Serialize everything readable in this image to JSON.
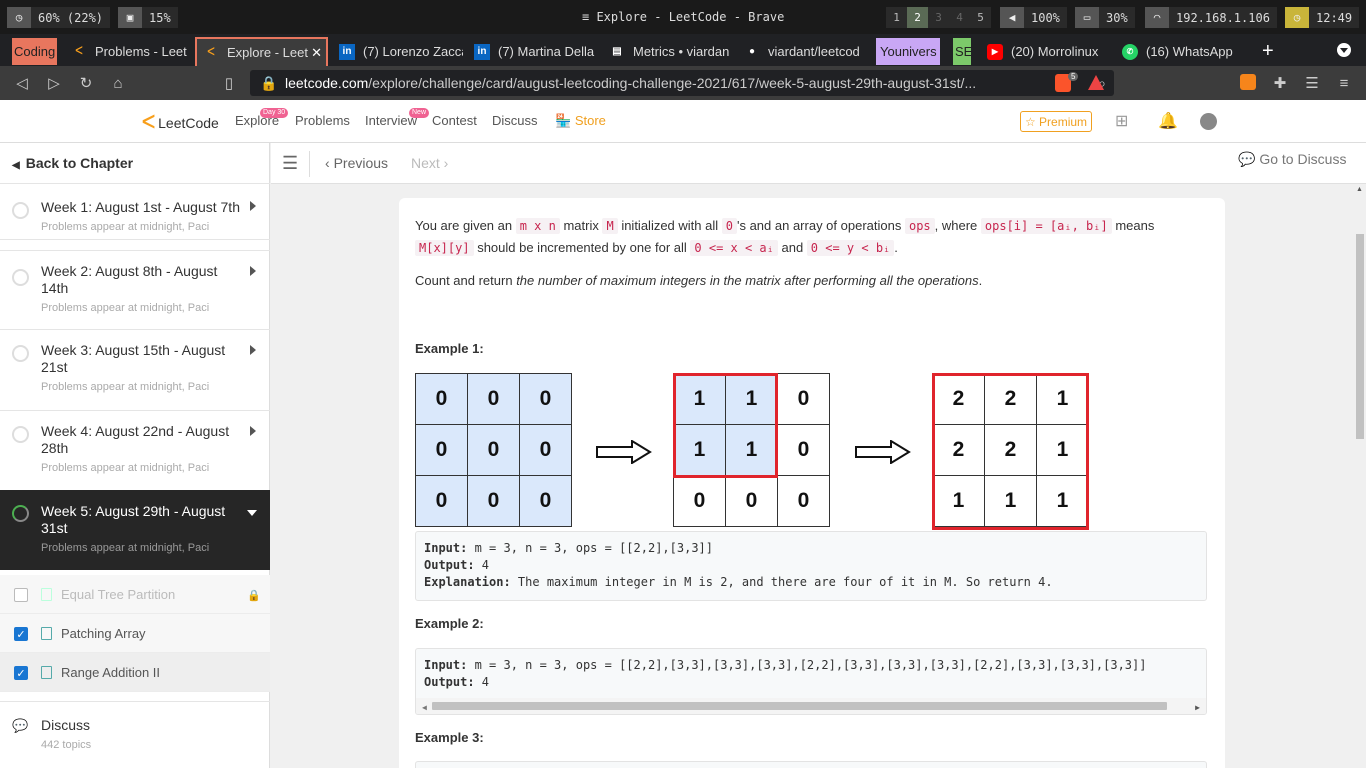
{
  "system": {
    "cpu": "60% (22%)",
    "mem": "15%",
    "window_title": "Explore - LeetCode - Brave",
    "workspaces": [
      "1",
      "2",
      "3",
      "4",
      "5"
    ],
    "volume": "100%",
    "battery": "30%",
    "ip": "192.168.1.106",
    "time": "12:49"
  },
  "tabs": [
    {
      "label": "Coding"
    },
    {
      "label": "Problems - LeetC"
    },
    {
      "label": "Explore - Leet"
    },
    {
      "label": "(7) Lorenzo Zacca"
    },
    {
      "label": "(7) Martina Della"
    },
    {
      "label": "Metrics • viardan"
    },
    {
      "label": "viardant/leetcod"
    },
    {
      "label": "Younivers"
    },
    {
      "label": "SE"
    },
    {
      "label": "(20) Morrolinux"
    },
    {
      "label": "(16) WhatsApp"
    }
  ],
  "address": {
    "domain": "leetcode.com",
    "path": "/explore/challenge/card/august-leetcoding-challenge-2021/617/week-5-august-29th-august-31st/...",
    "shield_count": "5"
  },
  "lcnav": {
    "logo": "LeetCode",
    "items": [
      "Explore",
      "Problems",
      "Interview",
      "Contest",
      "Discuss",
      "Store"
    ],
    "explore_badge": "Day 30",
    "interview_badge": "New",
    "premium": "Premium"
  },
  "sidebar": {
    "back": "Back to Chapter",
    "weeks": [
      {
        "title": "Week 1: August 1st - August 7th",
        "sub": "Problems appear at midnight, Pacific"
      },
      {
        "title": "Week 2: August 8th - August 14th",
        "sub": "Problems appear at midnight, Pacific"
      },
      {
        "title": "Week 3: August 15th - August 21st",
        "sub": "Problems appear at midnight, Pacific"
      },
      {
        "title": "Week 4: August 22nd - August 28th",
        "sub": "Problems appear at midnight, Pacific"
      },
      {
        "title": "Week 5: August 29th - August 31st",
        "sub": "Problems appear at midnight, Pacific"
      }
    ],
    "problems": [
      "Equal Tree Partition",
      "Patching Array",
      "Range Addition II"
    ],
    "discuss": "Discuss",
    "discuss_sub": "442 topics"
  },
  "toolbar": {
    "previous": "Previous",
    "next": "Next",
    "go_discuss": "Go to Discuss"
  },
  "problem": {
    "p1_a": "You are given an ",
    "p1_code1": "m x n",
    "p1_b": " matrix ",
    "p1_code2": "M",
    "p1_c": " initialized with all ",
    "p1_code3": "0",
    "p1_d": "'s and an array of operations ",
    "p1_code4": "ops",
    "p1_e": ", where ",
    "p1_code5": "ops[i] = [aᵢ, bᵢ]",
    "p1_f": " means",
    "p2_code1": "M[x][y]",
    "p2_a": " should be incremented by one for all ",
    "p2_code2": "0 <= x < aᵢ",
    "p2_b": " and ",
    "p2_code3": "0 <= y < bᵢ",
    "p2_c": ".",
    "p3_a": "Count and return ",
    "p3_em": "the number of maximum integers in the matrix after performing all the operations",
    "p3_b": ".",
    "ex1_title": "Example 1:",
    "grid1": [
      [
        "0",
        "0",
        "0"
      ],
      [
        "0",
        "0",
        "0"
      ],
      [
        "0",
        "0",
        "0"
      ]
    ],
    "grid2": [
      [
        "1",
        "1",
        "0"
      ],
      [
        "1",
        "1",
        "0"
      ],
      [
        "0",
        "0",
        "0"
      ]
    ],
    "grid3": [
      [
        "2",
        "2",
        "1"
      ],
      [
        "2",
        "2",
        "1"
      ],
      [
        "1",
        "1",
        "1"
      ]
    ],
    "ex1_input_label": "Input:",
    "ex1_input": " m = 3, n = 3, ops = [[2,2],[3,3]]",
    "ex1_output_label": "Output:",
    "ex1_output": " 4",
    "ex1_expl_label": "Explanation:",
    "ex1_expl": " The maximum integer in M is 2, and there are four of it in M. So return 4.",
    "ex2_title": "Example 2:",
    "ex2_input_label": "Input:",
    "ex2_input": " m = 3, n = 3, ops = [[2,2],[3,3],[3,3],[3,3],[2,2],[3,3],[3,3],[3,3],[2,2],[3,3],[3,3],[3,3]]",
    "ex2_output_label": "Output:",
    "ex2_output": " 4",
    "ex3_title": "Example 3:"
  }
}
